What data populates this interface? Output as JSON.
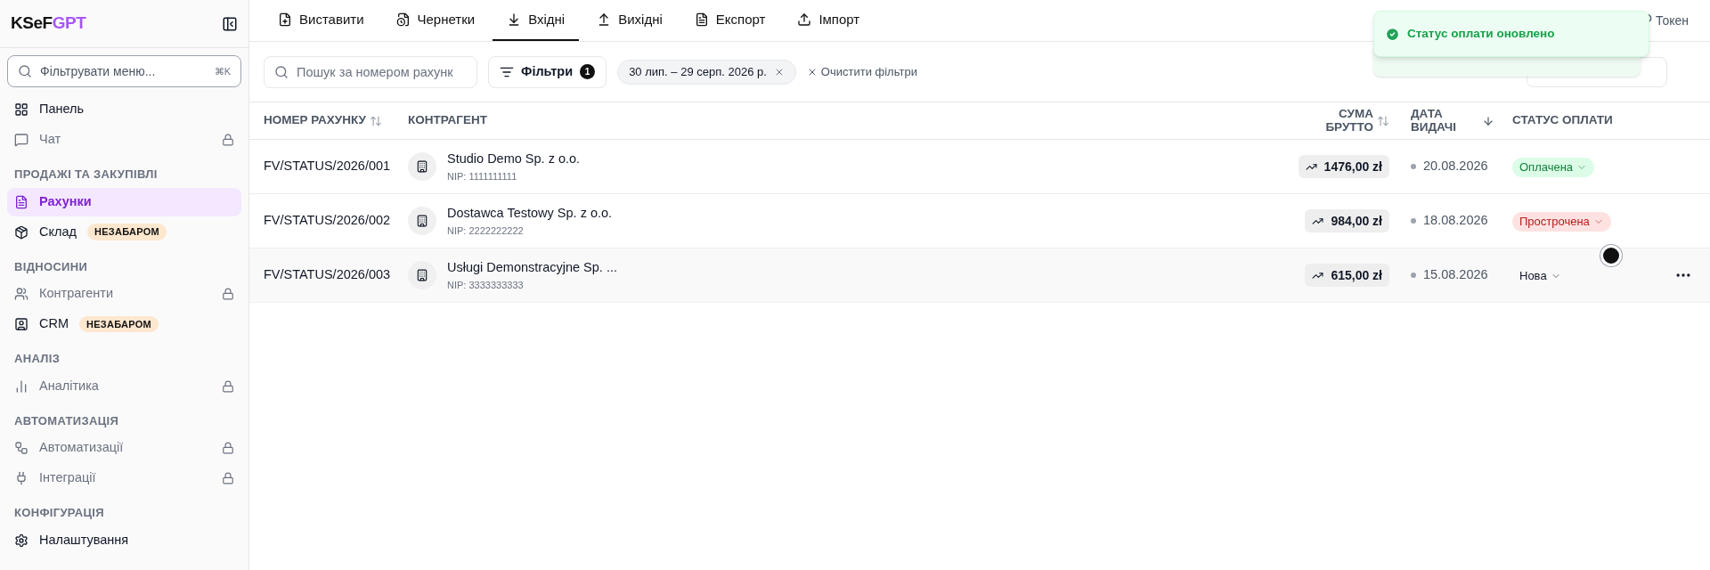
{
  "sidebar": {
    "logo": {
      "prefix": "KSeF",
      "suffix": "GPT"
    },
    "search": {
      "placeholder": "Фільтрувати меню...",
      "shortcut": "⌘K"
    },
    "sections": [
      {
        "items": [
          {
            "label": "Панель",
            "locked": false,
            "selected": false
          },
          {
            "label": "Чат",
            "locked": true,
            "selected": false
          }
        ]
      },
      {
        "title": "ПРОДАЖІ ТА ЗАКУПІВЛІ",
        "items": [
          {
            "label": "Рахунки",
            "locked": false,
            "selected": true
          },
          {
            "label": "Склад",
            "locked": false,
            "selected": false,
            "badge": "НЕЗАБАРОМ"
          }
        ]
      },
      {
        "title": "ВІДНОСИНИ",
        "items": [
          {
            "label": "Контрагенти",
            "locked": true,
            "selected": false
          },
          {
            "label": "CRM",
            "locked": false,
            "selected": false,
            "badge": "НЕЗАБАРОМ"
          }
        ]
      },
      {
        "title": "АНАЛІЗ",
        "items": [
          {
            "label": "Аналітика",
            "locked": true,
            "selected": false
          }
        ]
      },
      {
        "title": "АВТОМАТИЗАЦІЯ",
        "items": [
          {
            "label": "Автоматизації",
            "locked": true,
            "selected": false
          },
          {
            "label": "Інтеграції",
            "locked": true,
            "selected": false
          }
        ]
      },
      {
        "title": "КОНФІГУРАЦІЯ",
        "items": [
          {
            "label": "Налаштування",
            "locked": false,
            "selected": false
          }
        ]
      }
    ]
  },
  "tabs": [
    {
      "label": "Виставити",
      "selected": false
    },
    {
      "label": "Чернетки",
      "selected": false
    },
    {
      "label": "Вхідні",
      "selected": true
    },
    {
      "label": "Вихідні",
      "selected": false
    },
    {
      "label": "Експорт",
      "selected": false
    },
    {
      "label": "Імпорт",
      "selected": false
    }
  ],
  "token_button": "Токен",
  "toast": {
    "message": "Статус оплати оновлено"
  },
  "filters": {
    "search_placeholder": "Пошук за номером рахунк",
    "filter_button": "Фільтри",
    "filter_count": "1",
    "chips": [
      "30 лип. – 29 серп. 2026 р."
    ],
    "clear": "Очистити фільтри"
  },
  "table": {
    "columns": [
      {
        "label": "НОМЕР РАХУНКУ",
        "sortable": true,
        "sorted": false
      },
      {
        "label": "КОНТРАГЕНТ",
        "sortable": false,
        "sorted": false
      },
      {
        "label": "СУМА БРУТТО",
        "sortable": true,
        "sorted": false
      },
      {
        "label": "ДАТА ВИДАЧІ",
        "sortable": true,
        "sorted": true
      },
      {
        "label": "СТАТУС ОПЛАТИ",
        "sortable": false,
        "sorted": false
      }
    ],
    "rows": [
      {
        "number": "FV/STATUS/2026/001",
        "contractor": "Studio Demo Sp. z o.o.",
        "nip": "NIP: 1111111111",
        "amount": "1476,00 zł",
        "date": "20.08.2026",
        "status": {
          "label": "Оплачена",
          "kind": "paid"
        },
        "hovered": false
      },
      {
        "number": "FV/STATUS/2026/002",
        "contractor": "Dostawca Testowy Sp. z o.o.",
        "nip": "NIP: 2222222222",
        "amount": "984,00 zł",
        "date": "18.08.2026",
        "status": {
          "label": "Прострочена",
          "kind": "overdue"
        },
        "hovered": false
      },
      {
        "number": "FV/STATUS/2026/003",
        "contractor": "Usługi Demonstracyjne Sp. ...",
        "nip": "NIP: 3333333333",
        "amount": "615,00 zł",
        "date": "15.08.2026",
        "status": {
          "label": "Нова",
          "kind": "new"
        },
        "hovered": true
      }
    ]
  }
}
